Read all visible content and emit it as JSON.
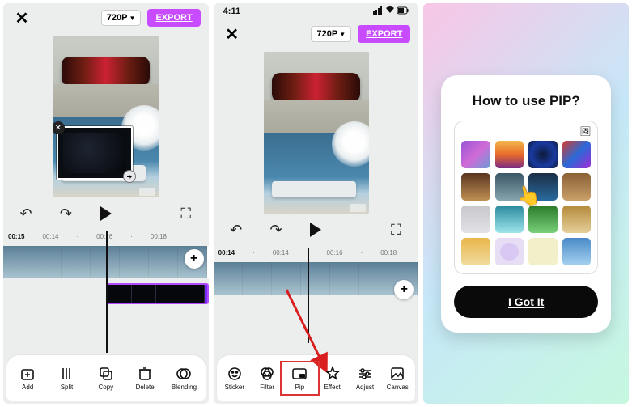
{
  "screen1": {
    "close": "✕",
    "quality": "720P",
    "export": "EXPORT",
    "undo": "↶",
    "redo": "↷",
    "fullscreen": "⛶",
    "ruler": [
      "00:15",
      "00:14",
      "·",
      "00:16",
      "·",
      "00:18"
    ],
    "add_clip": "+",
    "pip_x": "✕",
    "pip_go": "➔",
    "tools": [
      {
        "id": "add",
        "label": "Add"
      },
      {
        "id": "split",
        "label": "Split"
      },
      {
        "id": "copy",
        "label": "Copy"
      },
      {
        "id": "delete",
        "label": "Delete"
      },
      {
        "id": "blending",
        "label": "Blending"
      }
    ]
  },
  "screen2": {
    "time": "4:11",
    "status_icons": "▮▯▯ ⋮ 🔋",
    "close": "✕",
    "quality": "720P",
    "export": "EXPORT",
    "undo": "↶",
    "redo": "↷",
    "fullscreen": "⛶",
    "ruler": [
      "00:14",
      "·",
      "00:14",
      "·",
      "00:16",
      "·",
      "00:18"
    ],
    "add_clip": "+",
    "tools": [
      {
        "id": "sticker",
        "label": "Sticker"
      },
      {
        "id": "filter",
        "label": "Filter"
      },
      {
        "id": "pip",
        "label": "Pip",
        "highlight": true
      },
      {
        "id": "effect",
        "label": "Effect"
      },
      {
        "id": "adjust",
        "label": "Adjust"
      },
      {
        "id": "canvas",
        "label": "Canvas"
      }
    ]
  },
  "screen3": {
    "title": "How to use PIP?",
    "img_icon": "🖼",
    "hand": "👆",
    "got_it": "I Got It"
  }
}
